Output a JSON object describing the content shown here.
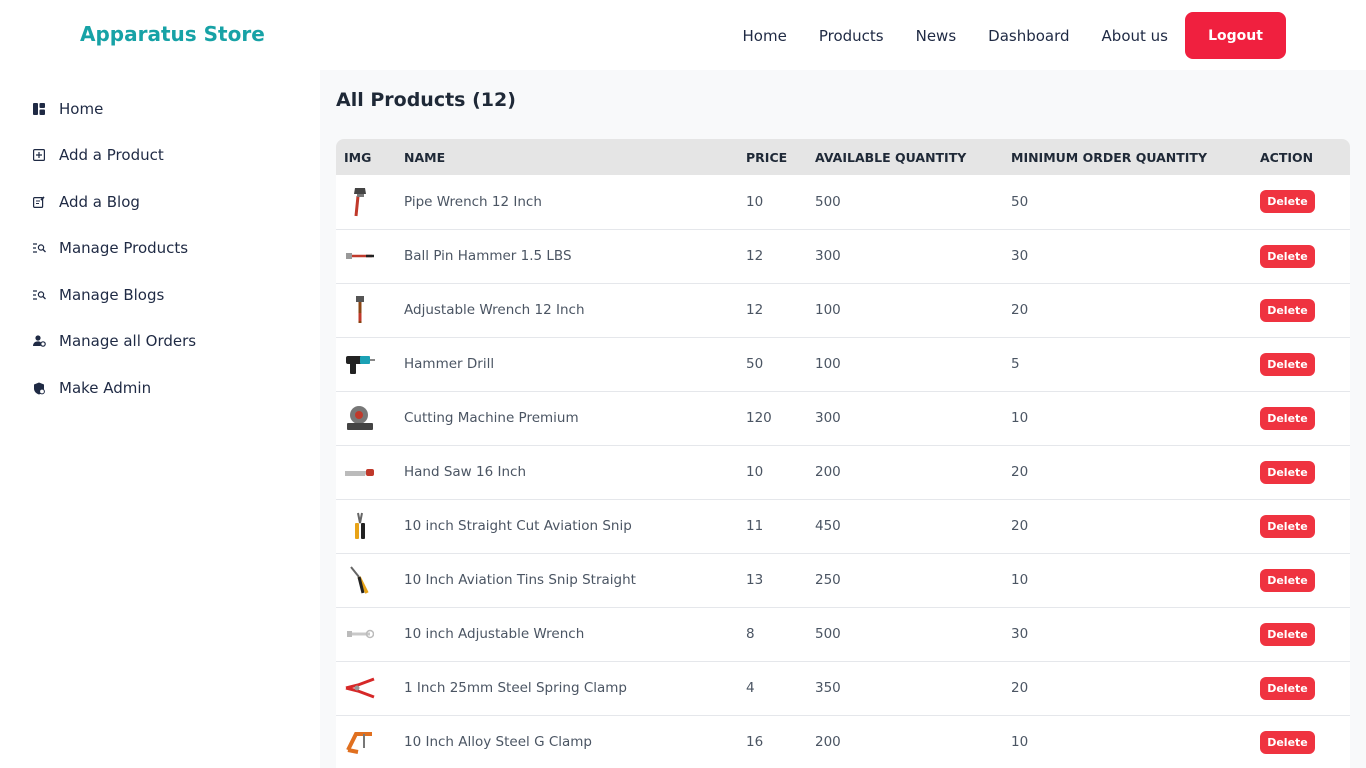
{
  "brand": "Apparatus Store",
  "nav": {
    "home": "Home",
    "products": "Products",
    "news": "News",
    "dashboard": "Dashboard",
    "about": "About us",
    "logout": "Logout"
  },
  "sidebar": {
    "items": [
      {
        "label": "Home",
        "icon": "dashboard-icon"
      },
      {
        "label": "Add a Product",
        "icon": "plus-square-icon"
      },
      {
        "label": "Add a Blog",
        "icon": "edit-note-icon"
      },
      {
        "label": "Manage Products",
        "icon": "search-list-icon"
      },
      {
        "label": "Manage Blogs",
        "icon": "search-list-icon"
      },
      {
        "label": "Manage all Orders",
        "icon": "user-settings-icon"
      },
      {
        "label": "Make Admin",
        "icon": "admin-shield-icon"
      }
    ]
  },
  "main": {
    "title": "All Products (12)"
  },
  "table": {
    "headers": [
      "IMG",
      "NAME",
      "PRICE",
      "AVAILABLE QUANTITY",
      "MINIMUM ORDER QUANTITY",
      "ACTION"
    ],
    "delete_label": "Delete",
    "rows": [
      {
        "name": "Pipe Wrench 12 Inch",
        "price": "10",
        "available": "500",
        "minimum": "50",
        "icon": "pipe-wrench-icon"
      },
      {
        "name": "Ball Pin Hammer 1.5 LBS",
        "price": "12",
        "available": "300",
        "minimum": "30",
        "icon": "hammer-icon"
      },
      {
        "name": "Adjustable Wrench 12 Inch",
        "price": "12",
        "available": "100",
        "minimum": "20",
        "icon": "wrench-icon"
      },
      {
        "name": "Hammer Drill",
        "price": "50",
        "available": "100",
        "minimum": "5",
        "icon": "drill-icon"
      },
      {
        "name": "Cutting Machine Premium",
        "price": "120",
        "available": "300",
        "minimum": "10",
        "icon": "cutting-machine-icon"
      },
      {
        "name": "Hand Saw 16 Inch",
        "price": "10",
        "available": "200",
        "minimum": "20",
        "icon": "hand-saw-icon"
      },
      {
        "name": "10 inch Straight Cut Aviation Snip",
        "price": "11",
        "available": "450",
        "minimum": "20",
        "icon": "snip-icon"
      },
      {
        "name": "10 Inch Aviation Tins Snip Straight",
        "price": "13",
        "available": "250",
        "minimum": "10",
        "icon": "tin-snip-icon"
      },
      {
        "name": "10 inch Adjustable Wrench",
        "price": "8",
        "available": "500",
        "minimum": "30",
        "icon": "adjustable-wrench-icon"
      },
      {
        "name": "1 Inch 25mm Steel Spring Clamp",
        "price": "4",
        "available": "350",
        "minimum": "20",
        "icon": "spring-clamp-icon"
      },
      {
        "name": "10 Inch Alloy Steel G Clamp",
        "price": "16",
        "available": "200",
        "minimum": "10",
        "icon": "g-clamp-icon"
      }
    ]
  },
  "colors": {
    "brand": "#17a2a6",
    "logout": "#f0203f",
    "delete": "#ef3340",
    "header_bg": "#e5e5e5",
    "main_bg": "#f8f9fa"
  }
}
